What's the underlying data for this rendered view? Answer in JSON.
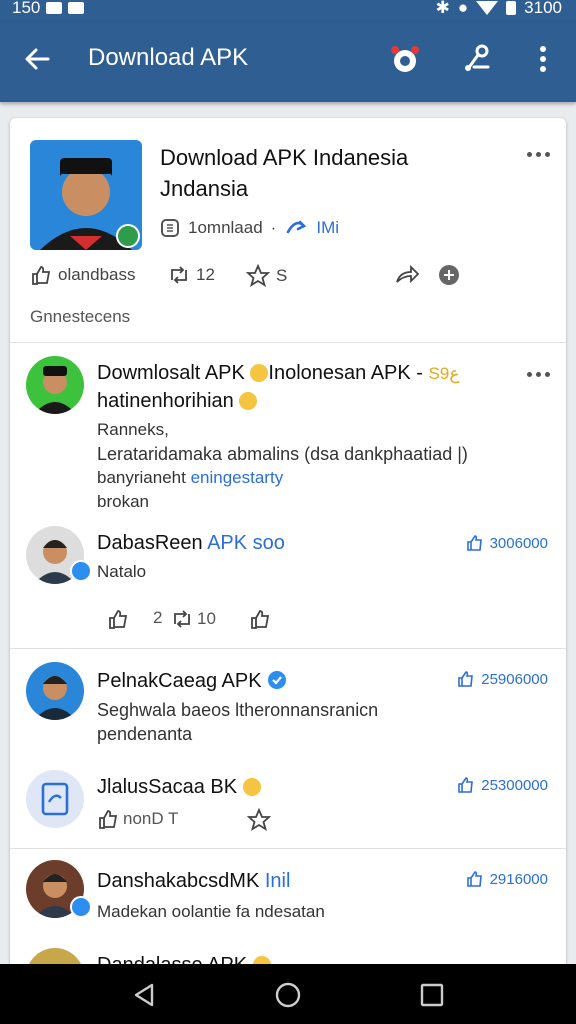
{
  "status_bar": {
    "time": "150",
    "clock": "3100"
  },
  "app_bar": {
    "title": "Download APK"
  },
  "hero": {
    "title": "Download APK Indanesia Jndansia",
    "meta_label": "1omnlaad",
    "meta_separator": "·",
    "meta_link": "IMi"
  },
  "hero_actions": {
    "react_label": "olandbass",
    "repost_count": "12",
    "star_count": "S"
  },
  "section": {
    "subheading": "Gnnestecens"
  },
  "posts": [
    {
      "name": "Dowmlosalt APK",
      "name_suffix": "Inolonesan APK -",
      "tag": "S9ع",
      "line2": "hatinenhorihian",
      "text1": "Ranneks,",
      "text2": "Lerataridamaka abmalins (dsa dankphaatiad |)",
      "text3_a": "banyrianeht ",
      "text3_b": "eningestarty",
      "text4": "brokan"
    },
    {
      "name": "DabasReen",
      "name_blue": "APK soo",
      "subtitle": "Natalo",
      "likes": "3006000",
      "reply_count": "2",
      "repost_count": "10"
    },
    {
      "name": "PelnakCaeag APK",
      "text1": "Seghwala baeos ltheronnansranicn",
      "text2": "pendenanta",
      "likes": "25906000"
    },
    {
      "name": "JlalusSacaa BK",
      "action_text": "nonD T",
      "likes": "25300000"
    },
    {
      "name": "DanshakabcsdMK",
      "name_blue": "Inil",
      "text1": "Madekan oolantie fa ndesatan",
      "likes": "2916000"
    },
    {
      "name": "Dandalasse APK"
    }
  ],
  "colors": {
    "app_bar": "#2f5f92",
    "link_blue": "#2b6fd6",
    "verified": "#2b8ef0"
  }
}
